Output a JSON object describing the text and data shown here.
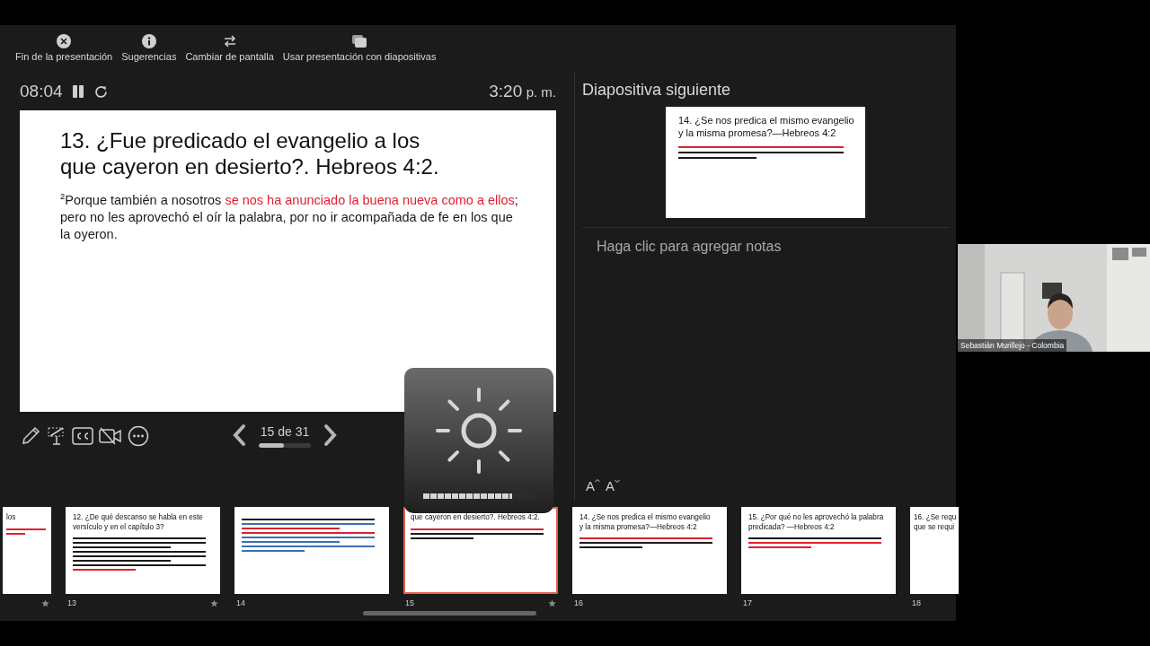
{
  "toolbar": [
    {
      "kind": "end",
      "label": "Fin de la presentación"
    },
    {
      "kind": "tips",
      "label": "Sugerencias"
    },
    {
      "kind": "switch",
      "label": "Cambiar de pantalla"
    },
    {
      "kind": "slides",
      "label": "Usar presentación con diapositivas"
    }
  ],
  "presenter": {
    "timer": "08:04",
    "clock": "3:20",
    "clock_suffix": "p. m."
  },
  "current_slide": {
    "title_lines": [
      "13. ¿Fue predicado el evangelio a los",
      "que cayeron en desierto?. Hebreos 4:2."
    ],
    "paragraphs": [
      {
        "verse": "2",
        "segments": [
          {
            "text": "Porque también a nosotros ",
            "color": "#1a1a1a"
          },
          {
            "text": "se nos ha anunciado la buena nueva como a ellos",
            "color": "#e0202e"
          },
          {
            "text": "; pero no les aprovechó el oír la palabra, por no ir acompañada de fe en los que la oyeron.",
            "color": "#1a1a1a"
          }
        ]
      }
    ]
  },
  "navigation": {
    "label": "15 de 31",
    "level": 0.48
  },
  "next_slide": {
    "heading": "Diapositiva siguiente",
    "slide": {
      "title_lines": [
        "14. ¿Se nos predica el mismo evangelio",
        "y la misma promesa?—Hebreos 4:2"
      ],
      "text_lines": [
        {
          "color": "#e0202e"
        },
        {
          "color": "#1a1a1a"
        },
        {
          "color": "#1a1a1a"
        }
      ]
    }
  },
  "notes": {
    "placeholder": "Haga clic para agregar notas"
  },
  "font_buttons": [
    {
      "kind": "increase",
      "label": "A"
    },
    {
      "kind": "decrease",
      "label": "A"
    }
  ],
  "thumbnails": [
    {
      "kind": "cut",
      "selected": false,
      "starred": true,
      "title_lines": [
        "los"
      ],
      "text_lines": [
        {
          "color": "#e0202e"
        },
        {
          "color": "#e0202e"
        }
      ]
    },
    {
      "kind": "full",
      "number": "13",
      "selected": false,
      "starred": true,
      "title_lines": [
        "12. ¿De qué descanso se habla en este",
        "versículo y en el capítulo 3?"
      ],
      "text_lines": [
        {
          "color": "#1a1a1a"
        },
        {
          "color": "#1a1a1a"
        },
        {
          "color": "#1a1a1a"
        },
        {
          "color": "#1a1a1a"
        },
        {
          "color": "#1a1a1a"
        },
        {
          "color": "#1a1a1a"
        },
        {
          "color": "#1a1a1a"
        },
        {
          "color": "#e0202e"
        }
      ]
    },
    {
      "kind": "full",
      "number": "14",
      "selected": false,
      "starred": false,
      "text_lines": [
        {
          "color": "#1a1a1a"
        },
        {
          "color": "#3a6fb5"
        },
        {
          "color": "#e0202e"
        },
        {
          "color": "#e0202e"
        },
        {
          "color": "#3a6fb5"
        },
        {
          "color": "#3a6fb5"
        },
        {
          "color": "#3a6fb5"
        },
        {
          "color": "#3a6fb5"
        }
      ]
    },
    {
      "kind": "full",
      "number": "15",
      "selected": true,
      "starred": true,
      "title_lines": [
        "que cayeron en desierto?. Hebreos 4:2."
      ],
      "text_lines": [
        {
          "color": "#e0202e"
        },
        {
          "color": "#1a1a1a"
        },
        {
          "color": "#1a1a1a"
        }
      ]
    },
    {
      "kind": "full",
      "number": "16",
      "selected": false,
      "starred": false,
      "title_lines": [
        "14. ¿Se nos predica el mismo evangelio",
        "y la misma promesa?—Hebreos 4:2"
      ],
      "text_lines": [
        {
          "color": "#e0202e"
        },
        {
          "color": "#1a1a1a"
        },
        {
          "color": "#1a1a1a"
        }
      ]
    },
    {
      "kind": "full",
      "number": "17",
      "selected": false,
      "starred": false,
      "title_lines": [
        "15. ¿Por qué no les aprovechó la palabra",
        "predicada? —Hebreos 4:2"
      ],
      "text_lines": [
        {
          "color": "#1a1a1a"
        },
        {
          "color": "#e0202e"
        },
        {
          "color": "#e0202e"
        }
      ]
    },
    {
      "kind": "cut",
      "number": "18",
      "selected": false,
      "starred": false,
      "title_lines": [
        "16. ¿Se requ",
        "que se requi"
      ]
    }
  ],
  "brightness": {
    "level": 0.8
  },
  "video": {
    "name": "Sebastián Murillejo - Colombia"
  }
}
